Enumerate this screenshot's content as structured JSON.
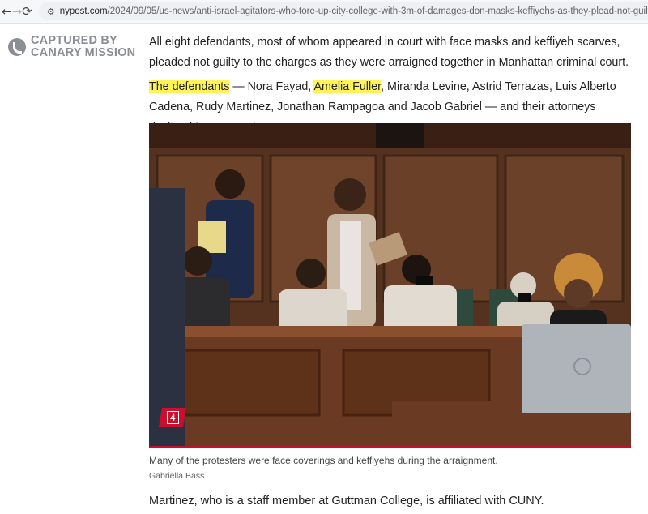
{
  "browser": {
    "back_icon": "←",
    "forward_icon": "→",
    "reload_icon": "⟳",
    "site_icon": "⚙",
    "url_domain": "nypost.com",
    "url_path": "/2024/09/05/us-news/anti-israel-agitators-who-tore-up-city-college-with-3m-of-damages-don-masks-keffiyehs-as-they-plead-not-guilty/"
  },
  "watermark": {
    "line1": "CAPTURED BY",
    "line2": "CANARY MISSION"
  },
  "article": {
    "para1": "All eight defendants, most of whom appeared in court with face masks and keffiyeh scarves, pleaded not guilty to the charges as they were arraigned together in Manhattan criminal court.",
    "para2_highlight1": "The defendants",
    "para2_seg1": " — Nora Fayad, ",
    "para2_highlight2": "Amelia Fuller",
    "para2_seg2": ", Miranda Levine, Astrid Terrazas, Luis Alberto Cadena, Rudy Martinez, Jonathan Rampagoa and Jacob Gabriel — and their attorneys declined to comment.",
    "photo_number": "4",
    "caption": "Many of the protesters were face coverings and keffiyehs during the arraignment.",
    "credit": "Gabriella Bass",
    "para3": "Martinez, who is a staff member at Guttman College, is affiliated with CUNY."
  },
  "colors": {
    "highlight": "#fff35a",
    "brand_red": "#c8102e",
    "watermark_gray": "#8b8e92"
  }
}
